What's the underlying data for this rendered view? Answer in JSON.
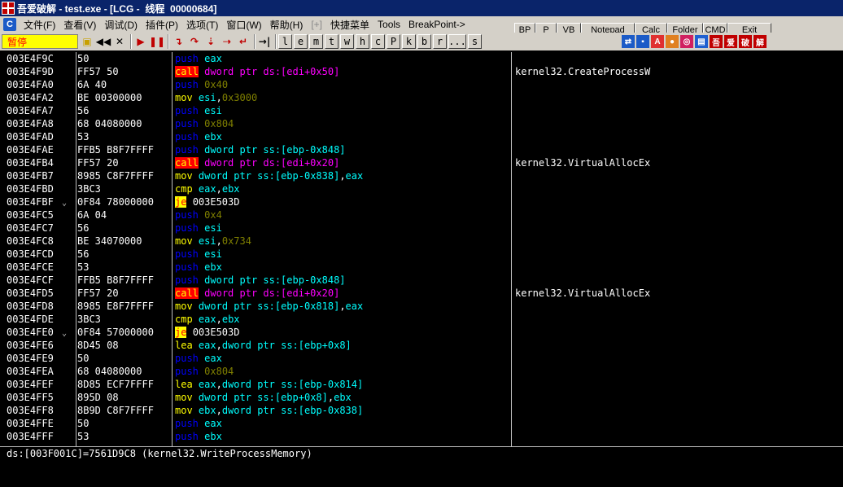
{
  "titlebar": {
    "text": "吾爱破解 - test.exe - [LCG -  线程  00000684]"
  },
  "menubar": {
    "app_icon": "C",
    "items": [
      {
        "label": "文件(F)"
      },
      {
        "label": "查看(V)"
      },
      {
        "label": "调试(D)"
      },
      {
        "label": "插件(P)"
      },
      {
        "label": "选项(T)"
      },
      {
        "label": "窗口(W)"
      },
      {
        "label": "帮助(H)"
      },
      {
        "label": "[+]"
      },
      {
        "label": "快捷菜单"
      },
      {
        "label": "Tools"
      },
      {
        "label": "BreakPoint->"
      }
    ]
  },
  "top_buttons": [
    "BP",
    "P",
    "VB",
    "Notepad",
    "Calc",
    "Folder",
    "CMD",
    "Exit"
  ],
  "toolbar": {
    "status": "暂停",
    "icons": [
      "open-icon",
      "rewind-icon",
      "close-icon",
      "run-icon",
      "pause-icon",
      "step-into-icon",
      "step-over-icon",
      "trace-into-icon",
      "trace-over-icon",
      "execute-till-return-icon",
      "goto-icon"
    ],
    "letters": [
      "l",
      "e",
      "m",
      "t",
      "w",
      "h",
      "c",
      "P",
      "k",
      "b",
      "r",
      "...",
      "s"
    ],
    "brand_chars": [
      "吾",
      "爱",
      "破",
      "解"
    ]
  },
  "disasm": {
    "rows": [
      {
        "addr": "003E4F9C",
        "jmp": "",
        "hex": "50",
        "mn": "push",
        "ops": [
          [
            "eax",
            "reg"
          ]
        ],
        "comment": ""
      },
      {
        "addr": "003E4F9D",
        "jmp": "",
        "hex": "FF57 50",
        "mn": "call",
        "ops": [
          [
            "dword ptr ds:[edi+0x50]",
            "call"
          ]
        ],
        "comment": "kernel32.CreateProcessW"
      },
      {
        "addr": "003E4FA0",
        "jmp": "",
        "hex": "6A 40",
        "mn": "push",
        "ops": [
          [
            "0x40",
            "imm"
          ]
        ],
        "comment": ""
      },
      {
        "addr": "003E4FA2",
        "jmp": "",
        "hex": "BE 00300000",
        "mn": "mov",
        "ops": [
          [
            "esi",
            "reg"
          ],
          [
            ",",
            "plain"
          ],
          [
            "0x3000",
            "imm"
          ]
        ],
        "comment": ""
      },
      {
        "addr": "003E4FA7",
        "jmp": "",
        "hex": "56",
        "mn": "push",
        "ops": [
          [
            "esi",
            "reg"
          ]
        ],
        "comment": ""
      },
      {
        "addr": "003E4FA8",
        "jmp": "",
        "hex": "68 04080000",
        "mn": "push",
        "ops": [
          [
            "0x804",
            "imm"
          ]
        ],
        "comment": ""
      },
      {
        "addr": "003E4FAD",
        "jmp": "",
        "hex": "53",
        "mn": "push",
        "ops": [
          [
            "ebx",
            "reg"
          ]
        ],
        "comment": ""
      },
      {
        "addr": "003E4FAE",
        "jmp": "",
        "hex": "FFB5 B8F7FFFF",
        "mn": "push",
        "ops": [
          [
            "dword ptr ss:[ebp-0x848]",
            "mem"
          ]
        ],
        "comment": ""
      },
      {
        "addr": "003E4FB4",
        "jmp": "",
        "hex": "FF57 20",
        "mn": "call",
        "ops": [
          [
            "dword ptr ds:[edi+0x20]",
            "call"
          ]
        ],
        "comment": "kernel32.VirtualAllocEx"
      },
      {
        "addr": "003E4FB7",
        "jmp": "",
        "hex": "8985 C8F7FFFF",
        "mn": "mov",
        "ops": [
          [
            "dword ptr ss:[ebp-0x838]",
            "mem"
          ],
          [
            ",",
            "plain"
          ],
          [
            "eax",
            "reg"
          ]
        ],
        "comment": ""
      },
      {
        "addr": "003E4FBD",
        "jmp": "",
        "hex": "3BC3",
        "mn": "cmp",
        "ops": [
          [
            "eax",
            "reg"
          ],
          [
            ",",
            "plain"
          ],
          [
            "ebx",
            "reg"
          ]
        ],
        "comment": ""
      },
      {
        "addr": "003E4FBF",
        "jmp": "⌄",
        "hex": "0F84 78000000",
        "mn": "je",
        "ops": [
          [
            "003E503D",
            "plain"
          ]
        ],
        "comment": ""
      },
      {
        "addr": "003E4FC5",
        "jmp": "",
        "hex": "6A 04",
        "mn": "push",
        "ops": [
          [
            "0x4",
            "imm"
          ]
        ],
        "comment": ""
      },
      {
        "addr": "003E4FC7",
        "jmp": "",
        "hex": "56",
        "mn": "push",
        "ops": [
          [
            "esi",
            "reg"
          ]
        ],
        "comment": ""
      },
      {
        "addr": "003E4FC8",
        "jmp": "",
        "hex": "BE 34070000",
        "mn": "mov",
        "ops": [
          [
            "esi",
            "reg"
          ],
          [
            ",",
            "plain"
          ],
          [
            "0x734",
            "imm"
          ]
        ],
        "comment": ""
      },
      {
        "addr": "003E4FCD",
        "jmp": "",
        "hex": "56",
        "mn": "push",
        "ops": [
          [
            "esi",
            "reg"
          ]
        ],
        "comment": ""
      },
      {
        "addr": "003E4FCE",
        "jmp": "",
        "hex": "53",
        "mn": "push",
        "ops": [
          [
            "ebx",
            "reg"
          ]
        ],
        "comment": ""
      },
      {
        "addr": "003E4FCF",
        "jmp": "",
        "hex": "FFB5 B8F7FFFF",
        "mn": "push",
        "ops": [
          [
            "dword ptr ss:[ebp-0x848]",
            "mem"
          ]
        ],
        "comment": ""
      },
      {
        "addr": "003E4FD5",
        "jmp": "",
        "hex": "FF57 20",
        "mn": "call",
        "ops": [
          [
            "dword ptr ds:[edi+0x20]",
            "call"
          ]
        ],
        "comment": "kernel32.VirtualAllocEx"
      },
      {
        "addr": "003E4FD8",
        "jmp": "",
        "hex": "8985 E8F7FFFF",
        "mn": "mov",
        "ops": [
          [
            "dword ptr ss:[ebp-0x818]",
            "mem"
          ],
          [
            ",",
            "plain"
          ],
          [
            "eax",
            "reg"
          ]
        ],
        "comment": ""
      },
      {
        "addr": "003E4FDE",
        "jmp": "",
        "hex": "3BC3",
        "mn": "cmp",
        "ops": [
          [
            "eax",
            "reg"
          ],
          [
            ",",
            "plain"
          ],
          [
            "ebx",
            "reg"
          ]
        ],
        "comment": ""
      },
      {
        "addr": "003E4FE0",
        "jmp": "⌄",
        "hex": "0F84 57000000",
        "mn": "je",
        "ops": [
          [
            "003E503D",
            "plain"
          ]
        ],
        "comment": ""
      },
      {
        "addr": "003E4FE6",
        "jmp": "",
        "hex": "8D45 08",
        "mn": "lea",
        "ops": [
          [
            "eax",
            "reg"
          ],
          [
            ",",
            "plain"
          ],
          [
            "dword ptr ss:[ebp+0x8]",
            "mem"
          ]
        ],
        "comment": ""
      },
      {
        "addr": "003E4FE9",
        "jmp": "",
        "hex": "50",
        "mn": "push",
        "ops": [
          [
            "eax",
            "reg"
          ]
        ],
        "comment": ""
      },
      {
        "addr": "003E4FEA",
        "jmp": "",
        "hex": "68 04080000",
        "mn": "push",
        "ops": [
          [
            "0x804",
            "imm"
          ]
        ],
        "comment": ""
      },
      {
        "addr": "003E4FEF",
        "jmp": "",
        "hex": "8D85 ECF7FFFF",
        "mn": "lea",
        "ops": [
          [
            "eax",
            "reg"
          ],
          [
            ",",
            "plain"
          ],
          [
            "dword ptr ss:[ebp-0x814]",
            "mem"
          ]
        ],
        "comment": ""
      },
      {
        "addr": "003E4FF5",
        "jmp": "",
        "hex": "895D 08",
        "mn": "mov",
        "ops": [
          [
            "dword ptr ss:[ebp+0x8]",
            "mem"
          ],
          [
            ",",
            "plain"
          ],
          [
            "ebx",
            "reg"
          ]
        ],
        "comment": ""
      },
      {
        "addr": "003E4FF8",
        "jmp": "",
        "hex": "8B9D C8F7FFFF",
        "mn": "mov",
        "ops": [
          [
            "ebx",
            "reg"
          ],
          [
            ",",
            "plain"
          ],
          [
            "dword ptr ss:[ebp-0x838]",
            "mem"
          ]
        ],
        "comment": ""
      },
      {
        "addr": "003E4FFE",
        "jmp": "",
        "hex": "50",
        "mn": "push",
        "ops": [
          [
            "eax",
            "reg"
          ]
        ],
        "comment": ""
      },
      {
        "addr": "003E4FFF",
        "jmp": "",
        "hex": "53",
        "mn": "push",
        "ops": [
          [
            "ebx",
            "reg"
          ]
        ],
        "comment": ""
      }
    ]
  },
  "info_pane": {
    "text": "ds:[003F001C]=7561D9C8 (kernel32.WriteProcessMemory)"
  },
  "colors": {
    "background": "#000000",
    "push": "#0000ff",
    "call_bg": "#ff0000",
    "mnemonic": "#ffff00",
    "memory_operand": "#00ffff",
    "call_operand": "#ff00ff",
    "immediate": "#808000",
    "jump_highlight": "#ffff00",
    "pause_bg": "#ffff00",
    "pause_text": "#ff0000"
  }
}
